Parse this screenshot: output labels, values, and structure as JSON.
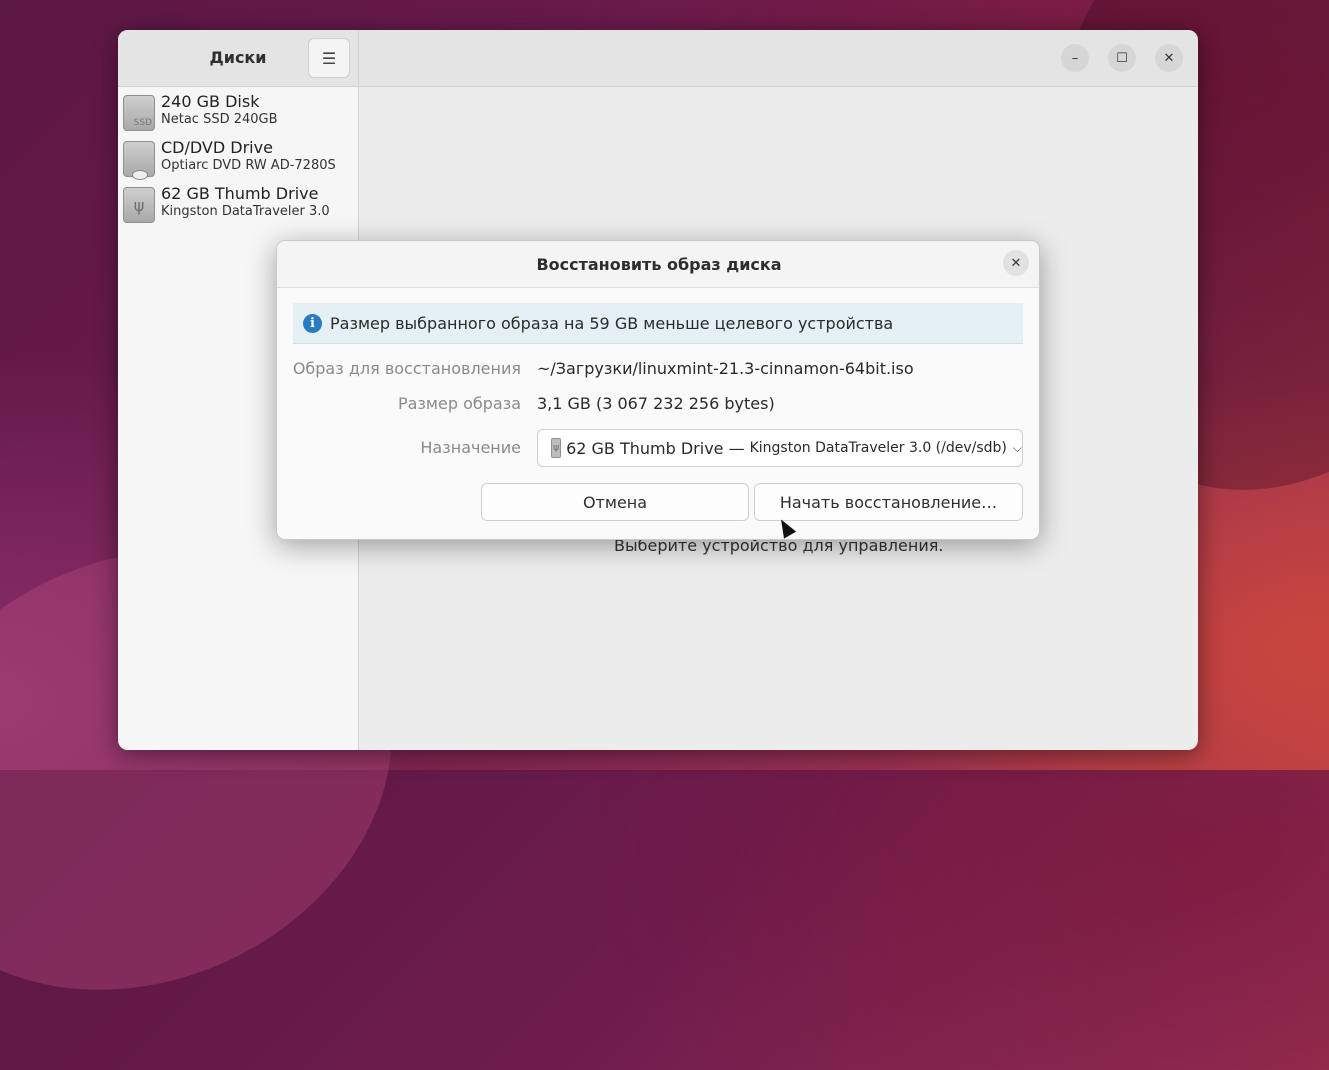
{
  "sidebar": {
    "title": "Диски",
    "drives": [
      {
        "name": "240 GB Disk",
        "model": "Netac SSD 240GB",
        "icon": "ssd-icon",
        "badge": "SSD"
      },
      {
        "name": "CD/DVD Drive",
        "model": "Optiarc DVD RW AD-7280S",
        "icon": "dvd-icon"
      },
      {
        "name": "62 GB Thumb Drive",
        "model": "Kingston DataTraveler 3.0",
        "icon": "usb-icon"
      }
    ]
  },
  "main": {
    "placeholder": "Выберите устройство для управления."
  },
  "dialog": {
    "title": "Восстановить образ диска",
    "info": "Размер выбранного образа на 59 GB меньше целевого устройства",
    "image_label": "Образ для восстановления",
    "image_value": "~/Загрузки/linuxmint-21.3-cinnamon-64bit.iso",
    "size_label": "Размер образа",
    "size_value": "3,1 GB (3 067 232 256 bytes)",
    "dest_label": "Назначение",
    "dest_main": "62 GB Thumb Drive —",
    "dest_sub": "Kingston DataTraveler 3.0 (/dev/sdb)",
    "cancel_label": "Отмена",
    "start_label": "Начать восстановление…"
  },
  "colors": {
    "info_accent": "#2a7bc0",
    "info_bg": "#e5f0f5"
  }
}
